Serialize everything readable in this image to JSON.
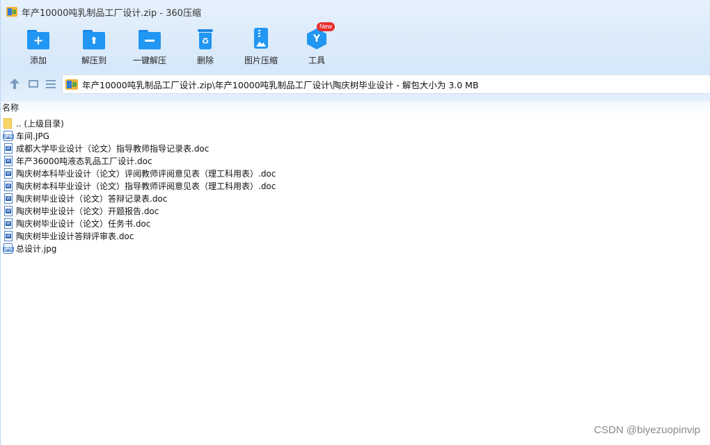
{
  "window": {
    "title": "年产10000吨乳制品工厂设计.zip - 360压缩"
  },
  "toolbar": {
    "items": [
      {
        "label": "添加",
        "icon": "add-folder-icon"
      },
      {
        "label": "解压到",
        "icon": "extract-to-icon"
      },
      {
        "label": "一键解压",
        "icon": "one-click-extract-icon"
      },
      {
        "label": "删除",
        "icon": "recycle-bin-icon"
      },
      {
        "label": "图片压缩",
        "icon": "image-compress-icon"
      },
      {
        "label": "工具",
        "icon": "tools-icon",
        "badge": "New"
      }
    ]
  },
  "address_bar": {
    "path": "年产10000吨乳制品工厂设计.zip\\年产10000吨乳制品工厂设计\\陶庆树毕业设计 - 解包大小为 3.0 MB"
  },
  "file_list": {
    "column_name": "名称",
    "items": [
      {
        "name": ".. (上级目录)",
        "type": "folder"
      },
      {
        "name": "车间.JPG",
        "type": "jpg"
      },
      {
        "name": "成都大学毕业设计（论文）指导教师指导记录表.doc",
        "type": "doc"
      },
      {
        "name": "年产36000吨液态乳品工厂设计.doc",
        "type": "doc"
      },
      {
        "name": "陶庆树本科毕业设计（论文）评阅教师评阅意见表（理工科用表）.doc",
        "type": "doc"
      },
      {
        "name": "陶庆树本科毕业设计（论文）指导教师评阅意见表（理工科用表）.doc",
        "type": "doc"
      },
      {
        "name": "陶庆树毕业设计（论文）答辩记录表.doc",
        "type": "doc"
      },
      {
        "name": "陶庆树毕业设计（论文）开题报告.doc",
        "type": "doc"
      },
      {
        "name": "陶庆树毕业设计（论文）任务书.doc",
        "type": "doc"
      },
      {
        "name": "陶庆树毕业设计答辩评审表.doc",
        "type": "doc"
      },
      {
        "name": "总设计.jpg",
        "type": "jpg"
      }
    ]
  },
  "watermark": "CSDN @biyezuopinvip",
  "colors": {
    "accent": "#2196f3",
    "badge": "#e62e2e",
    "toolbar_bg": "#dcebfa"
  }
}
